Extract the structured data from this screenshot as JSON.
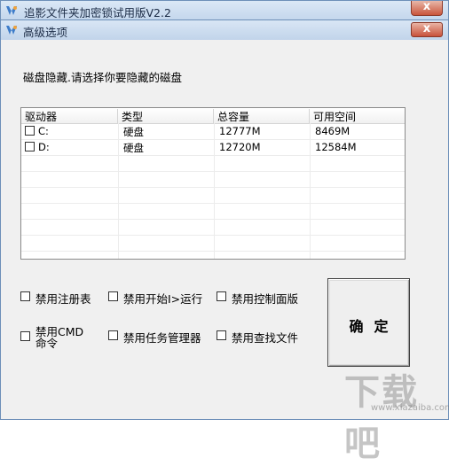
{
  "outer_window": {
    "title": "追影文件夹加密锁试用版V2.2",
    "close_glyph": "x"
  },
  "dialog": {
    "title": "高级选项",
    "close_glyph": "x"
  },
  "prompt_text": "磁盘隐藏.请选择你要隐藏的磁盘",
  "table": {
    "columns": [
      "驱动器",
      "类型",
      "总容量",
      "可用空间"
    ],
    "rows": [
      {
        "drive": "C:",
        "type": "硬盘",
        "total": "12777M",
        "free": "8469M",
        "checked": false
      },
      {
        "drive": "D:",
        "type": "硬盘",
        "total": "12720M",
        "free": "12584M",
        "checked": false
      }
    ]
  },
  "options": {
    "registry": "禁用注册表",
    "start_run": "禁用开始I>运行",
    "control_panel": "禁用控制面版",
    "cmd": "禁用CMD命令",
    "task_manager": "禁用任务管理器",
    "find_files": "禁用查找文件"
  },
  "ok_button": "确定",
  "watermark": {
    "text": "下载吧",
    "url": "www.xiazaiba.com"
  },
  "colors": {
    "title_bar": "#c3d6ec",
    "close_button": "#c8513a",
    "dialog_bg": "#f0f0f0"
  }
}
